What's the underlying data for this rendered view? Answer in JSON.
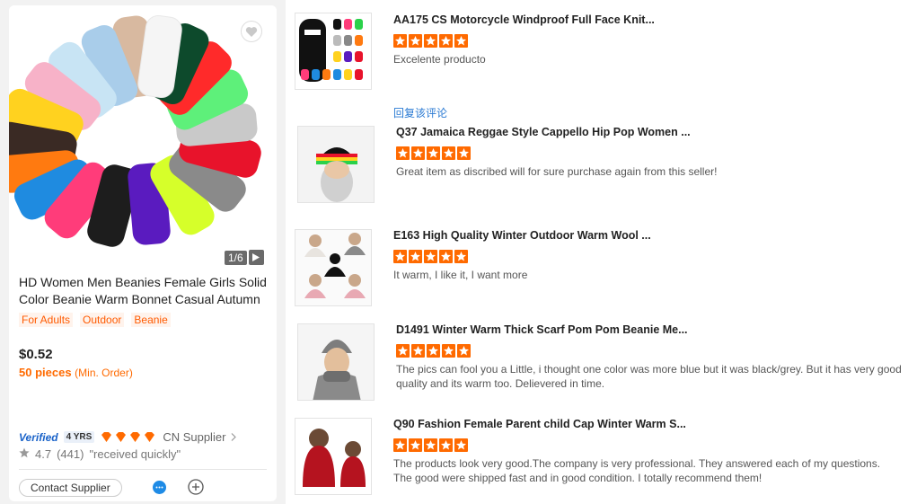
{
  "product": {
    "title": "HD Women Men Beanies Female Girls Solid Color Beanie Warm Bonnet Casual Autumn",
    "image_counter": "1/6",
    "tags": [
      "For Adults",
      "Outdoor",
      "Beanie"
    ],
    "price": "$0.52",
    "moq_qty": "50 pieces",
    "moq_label": "(Min. Order)",
    "verified_label": "Verified",
    "years": "4 YRS",
    "supplier_label": "CN Supplier",
    "rating": "4.7",
    "rating_count": "(441)",
    "review_quote": "\"received quickly\"",
    "contact_label": "Contact Supplier",
    "accent_color": "#ff6a00"
  },
  "reviews": [
    {
      "title": "AA175 CS Motorcycle Windproof Full Face Knit...",
      "stars": 5,
      "text": "Excelente producto",
      "reply": "回复该评论"
    },
    {
      "title": "Q37 Jamaica Reggae Style Cappello Hip Pop Women ...",
      "stars": 5,
      "text": "Great item as discribed will for sure purchase again from this seller!"
    },
    {
      "title": "E163 High Quality Winter Outdoor Warm Wool ...",
      "stars": 5,
      "text": "It warm, I like it, I want more"
    },
    {
      "title": "D1491 Winter Warm Thick Scarf Pom Pom Beanie Me...",
      "stars": 5,
      "text": "The pics can fool you a Little, i thought one color was more blue but it was black/grey. But it has very good quality and its warm too. Delievered in time."
    },
    {
      "title": "Q90 Fashion Female Parent child Cap Winter Warm S...",
      "stars": 5,
      "text": "The products look very good.The company is very professional. They answered each of my questions. The good were shipped fast and in good condition. I totally recommend them!"
    }
  ]
}
